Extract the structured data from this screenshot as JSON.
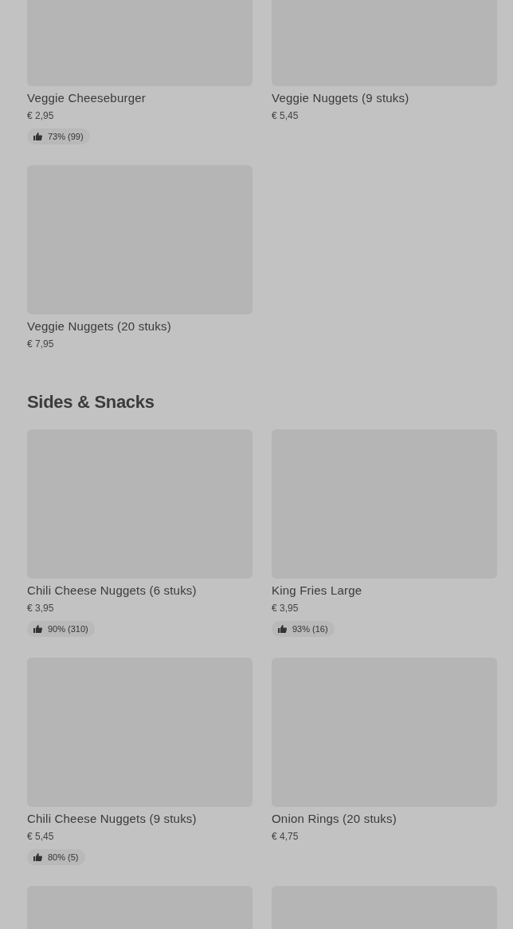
{
  "sections": [
    {
      "items": [
        {
          "kind": "product",
          "name": "Veggie Cheeseburger",
          "price": "€ 2,95",
          "rating": "73% (99)"
        },
        {
          "kind": "product",
          "name": "Veggie Nuggets (9 stuks)",
          "price": "€ 5,45"
        },
        {
          "kind": "product",
          "name": "Veggie Nuggets (20 stuks)",
          "price": "€ 7,95"
        }
      ]
    },
    {
      "title": "Sides & Snacks",
      "items": [
        {
          "kind": "product",
          "name": "Chili Cheese Nuggets (6 stuks)",
          "price": "€ 3,95",
          "rating": "90% (310)"
        },
        {
          "kind": "product",
          "name": "King Fries Large",
          "price": "€ 3,95",
          "rating": "93% (16)"
        },
        {
          "kind": "product",
          "name": "Chili Cheese Nuggets (9 stuks)",
          "price": "€ 5,45",
          "rating": "80% (5)"
        },
        {
          "kind": "product",
          "name": "Onion Rings (20 stuks)",
          "price": "€ 4,75"
        },
        {
          "kind": "image-only"
        },
        {
          "kind": "image-only"
        }
      ]
    }
  ]
}
